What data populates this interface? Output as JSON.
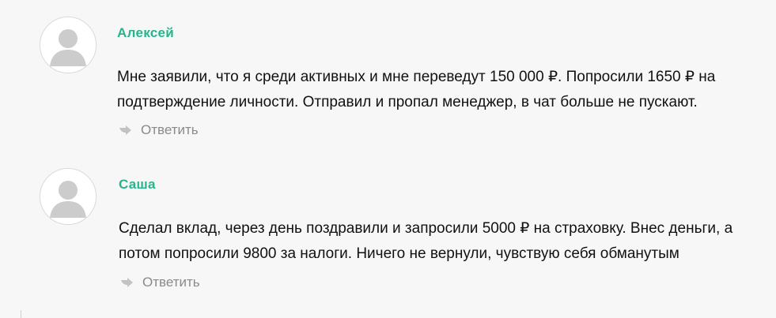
{
  "comments": [
    {
      "author": "Алексей",
      "avatar_icon": "user-avatar-icon",
      "text": "Мне заявили, что я среди активных и мне переведут 150 000 ₽. Попросили 1650 ₽ на подтверждение личности. Отправил и пропал менеджер, в чат больше не пускают.",
      "reply_label": "Ответить",
      "reply_icon": "reply-arrow-icon"
    },
    {
      "author": "Саша",
      "avatar_icon": "user-avatar-icon",
      "text": "Сделал вклад, через день поздравили и запросили 5000 ₽ на страховку. Внес деньги, а потом попросили 9800 за налоги. Ничего не вернули, чувствую себя обманутым",
      "reply_label": "Ответить",
      "reply_icon": "reply-arrow-icon"
    }
  ],
  "colors": {
    "background": "#f7f7f7",
    "author": "#2bb38c",
    "text": "#111111",
    "reply": "#8a8a8a",
    "avatar_silhouette": "#cccccc"
  }
}
